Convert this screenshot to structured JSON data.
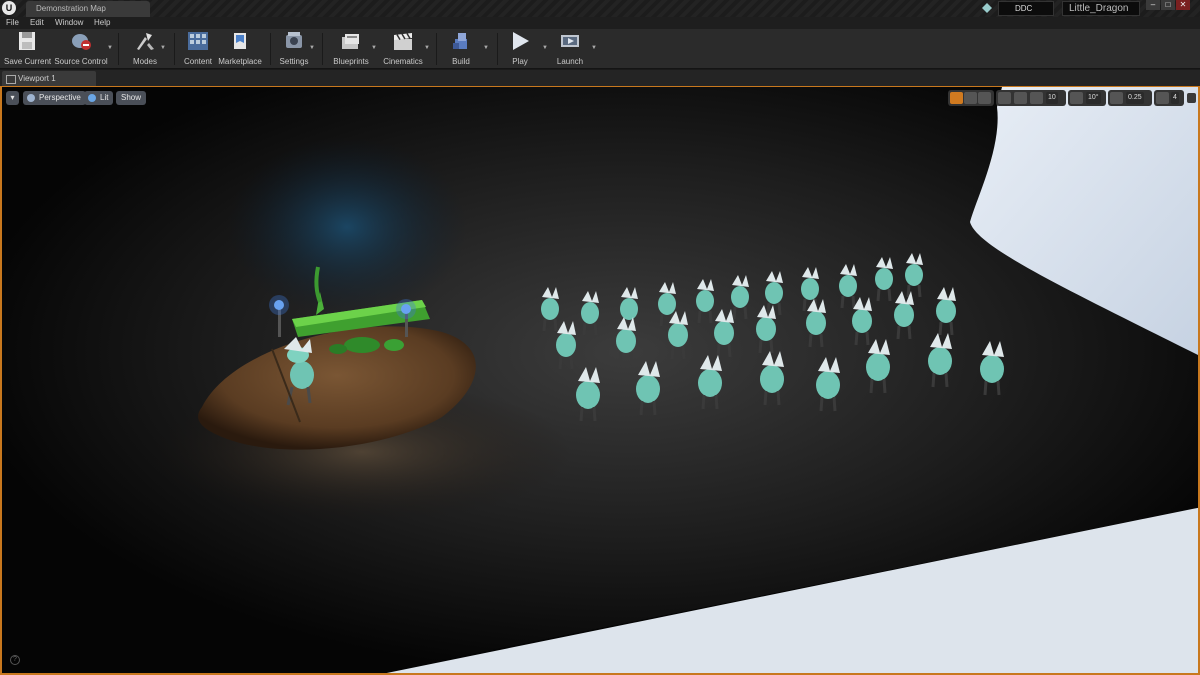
{
  "window": {
    "logo": "U",
    "doc_tab_title": "Demonstration Map",
    "ddc_label": "DDC",
    "project_name": "Little_Dragon",
    "minimize": "–",
    "maximize": "□",
    "close": "✕"
  },
  "menu": {
    "items": [
      "File",
      "Edit",
      "Window",
      "Help"
    ]
  },
  "toolbar": {
    "items": [
      {
        "label": "Save Current",
        "icon": "save-icon"
      },
      {
        "label": "Source Control",
        "icon": "source-control-icon"
      },
      {
        "label": "Modes",
        "icon": "modes-icon"
      },
      {
        "label": "Content",
        "icon": "content-icon"
      },
      {
        "label": "Marketplace",
        "icon": "marketplace-icon"
      },
      {
        "label": "Settings",
        "icon": "settings-icon"
      },
      {
        "label": "Blueprints",
        "icon": "blueprints-icon"
      },
      {
        "label": "Cinematics",
        "icon": "cinematics-icon"
      },
      {
        "label": "Build",
        "icon": "build-icon"
      },
      {
        "label": "Play",
        "icon": "play-icon"
      },
      {
        "label": "Launch",
        "icon": "launch-icon"
      }
    ]
  },
  "viewport_tab": {
    "label": "Viewport 1"
  },
  "viewport": {
    "perspective_label": "Perspective",
    "lit_label": "Lit",
    "show_label": "Show",
    "grid_snap": "10",
    "rotation_snap": "10°",
    "scale_snap": "0.25",
    "camera_speed": "4",
    "help": "?"
  },
  "colors": {
    "accent_border": "#c8781e",
    "creature": "#6fc4b3",
    "log": "#3f9a2f",
    "ground": "#6b4a2e",
    "wall": "#dfe8f2"
  }
}
